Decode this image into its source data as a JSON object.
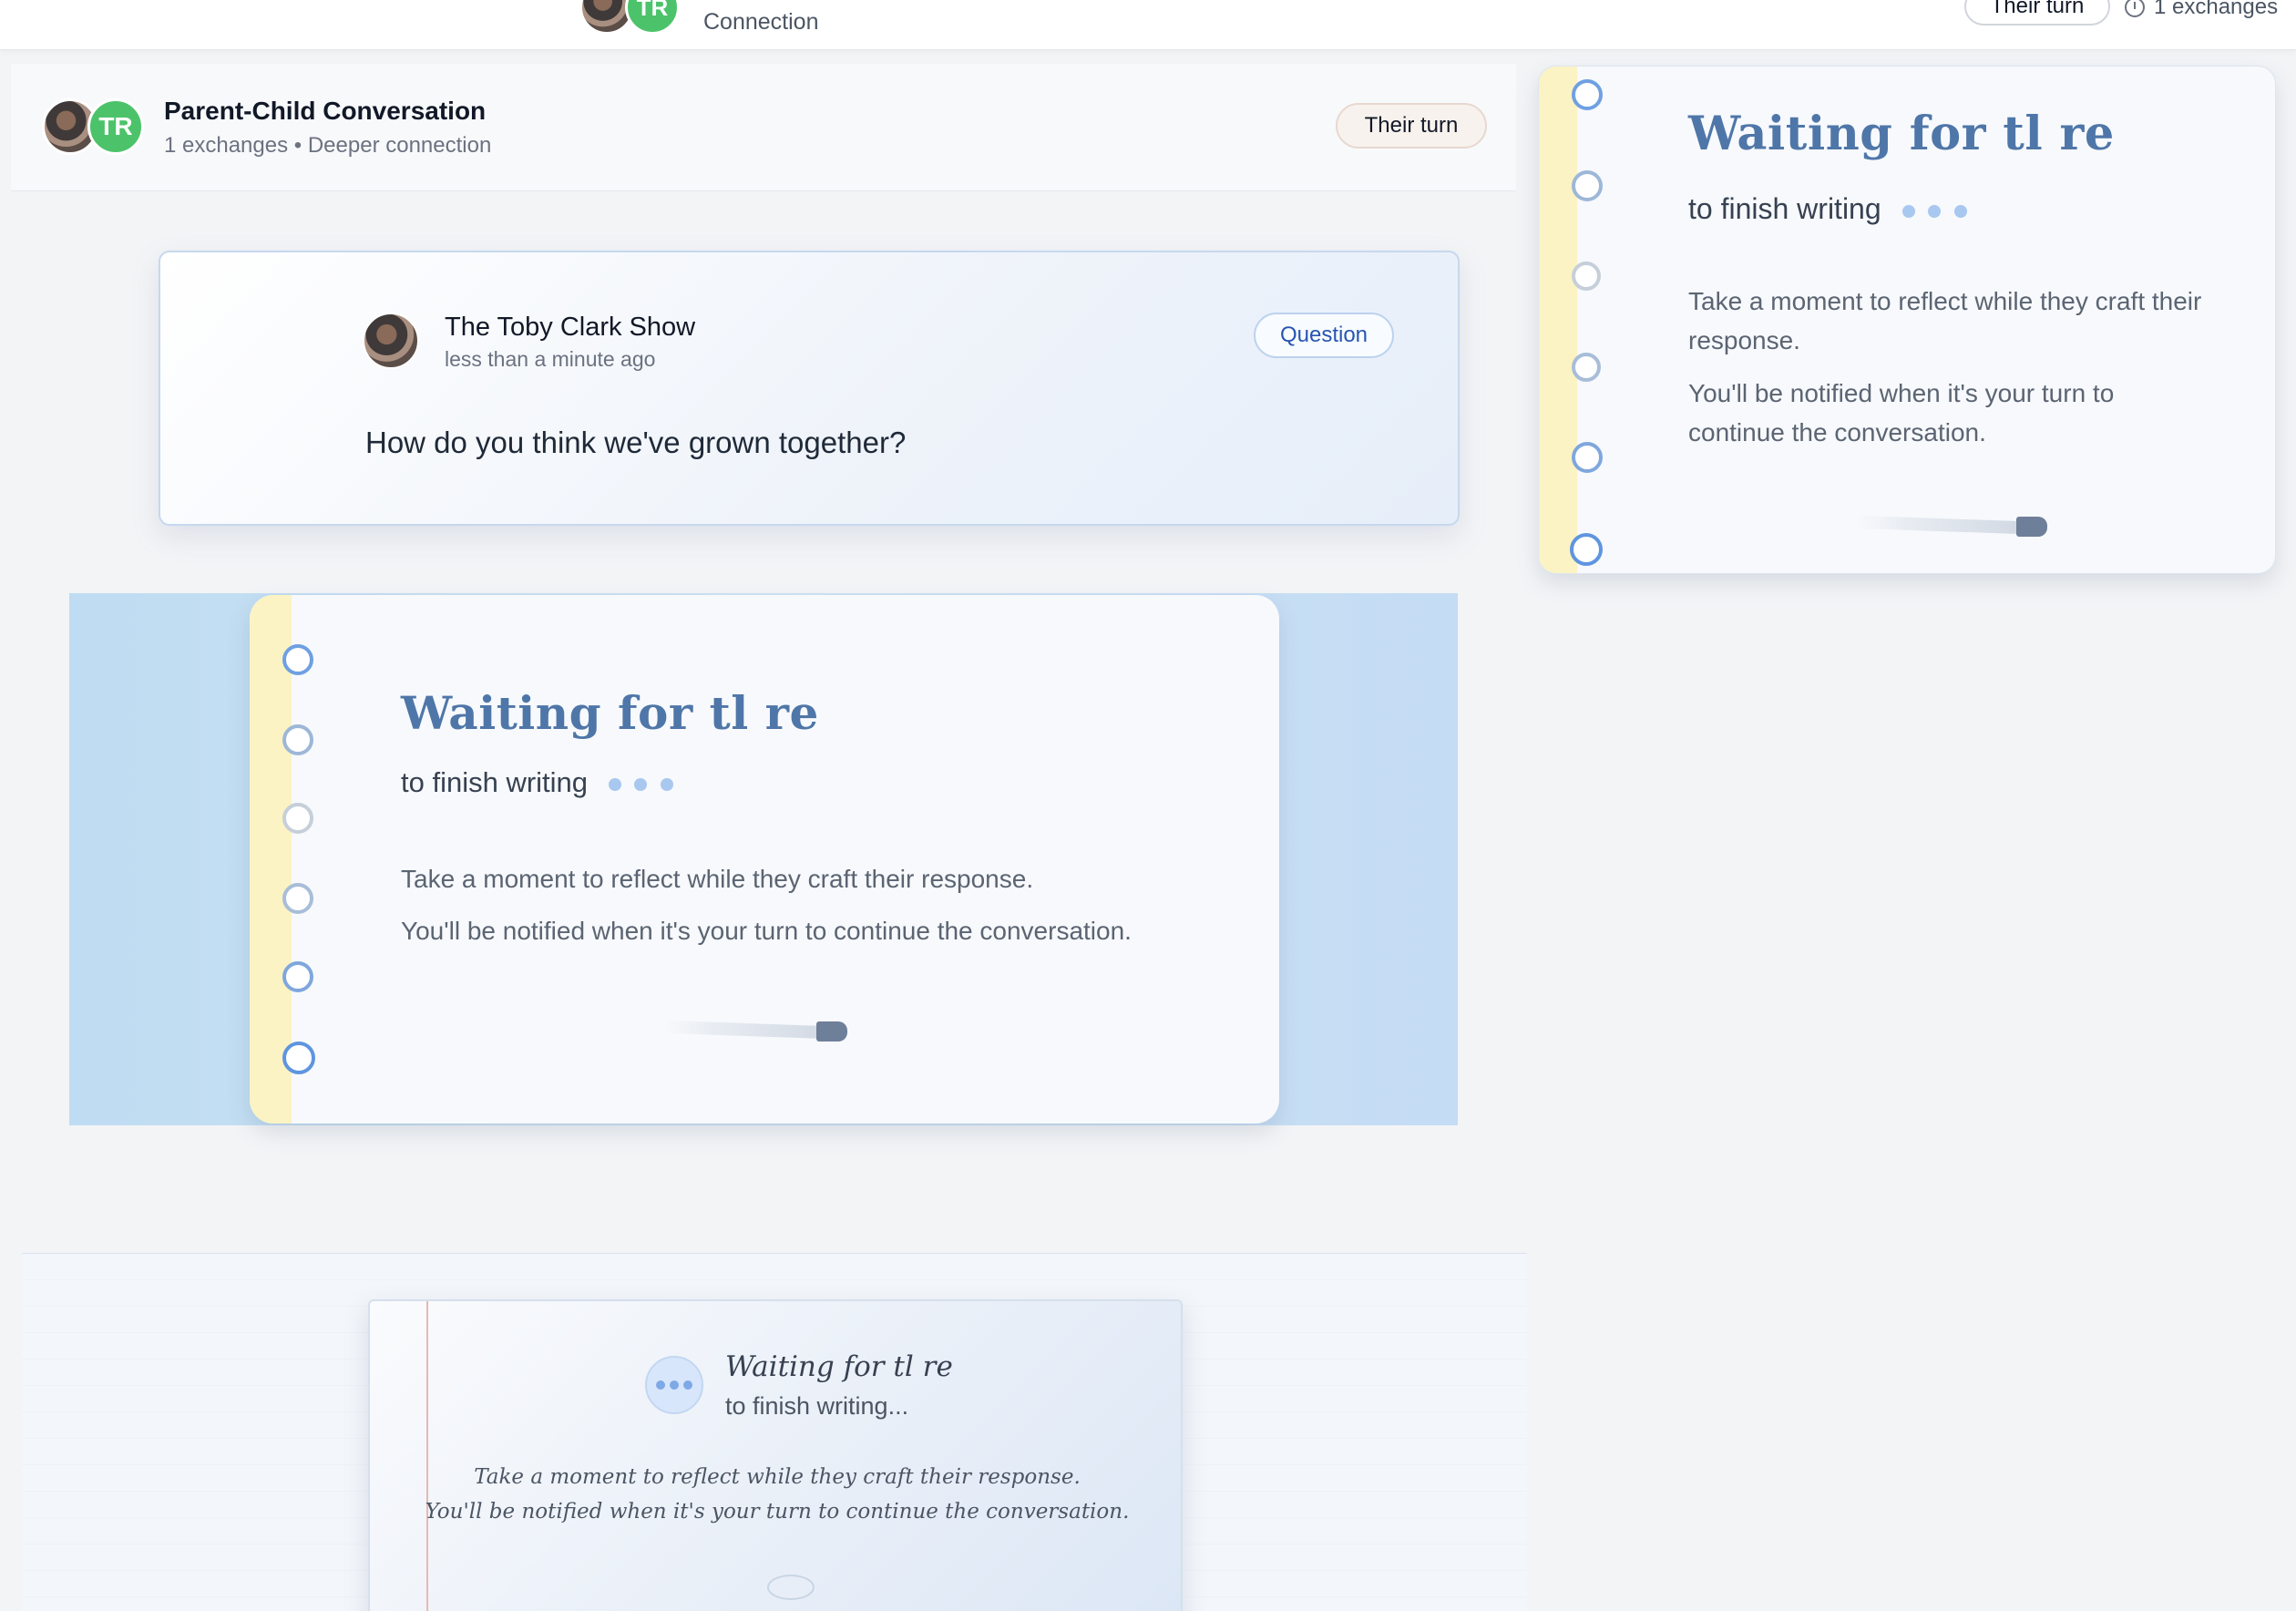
{
  "topbar": {
    "partner_initials": "TR",
    "subtitle": "Connection",
    "turn_label": "Their turn",
    "exchanges": "1 exchanges"
  },
  "conversation": {
    "partner_initials": "TR",
    "title": "Parent-Child Conversation",
    "meta": "1 exchanges • Deeper connection",
    "turn_label": "Their turn"
  },
  "question_card": {
    "author": "The Toby Clark Show",
    "time": "less than a minute ago",
    "badge": "Question",
    "text": "How do you think we've grown together?"
  },
  "waiting_main": {
    "title": "Waiting for tl re",
    "subtitle": "to finish writing",
    "line1": "Take a moment to reflect while they craft their response.",
    "line2": "You'll be notified when it's your turn to continue the conversation."
  },
  "waiting_side": {
    "title": "Waiting for tl re",
    "subtitle": "to finish writing",
    "line1": "Take a moment to reflect while they craft their response.",
    "line2": "You'll be notified when it's your turn to continue the conversation."
  },
  "waiting_paper": {
    "title": "Waiting for tl re",
    "subtitle": "to finish writing...",
    "line1": "Take a moment to reflect while they craft their response.",
    "line2": "You'll be notified when it's your turn to continue the conversation."
  },
  "colors": {
    "accent_blue": "#4f76a8",
    "badge_blue": "#2855b0",
    "avatar_green": "#4cc36a",
    "panel_blue": "#c4dcf4",
    "notebook_strip": "#fbf3c4"
  }
}
